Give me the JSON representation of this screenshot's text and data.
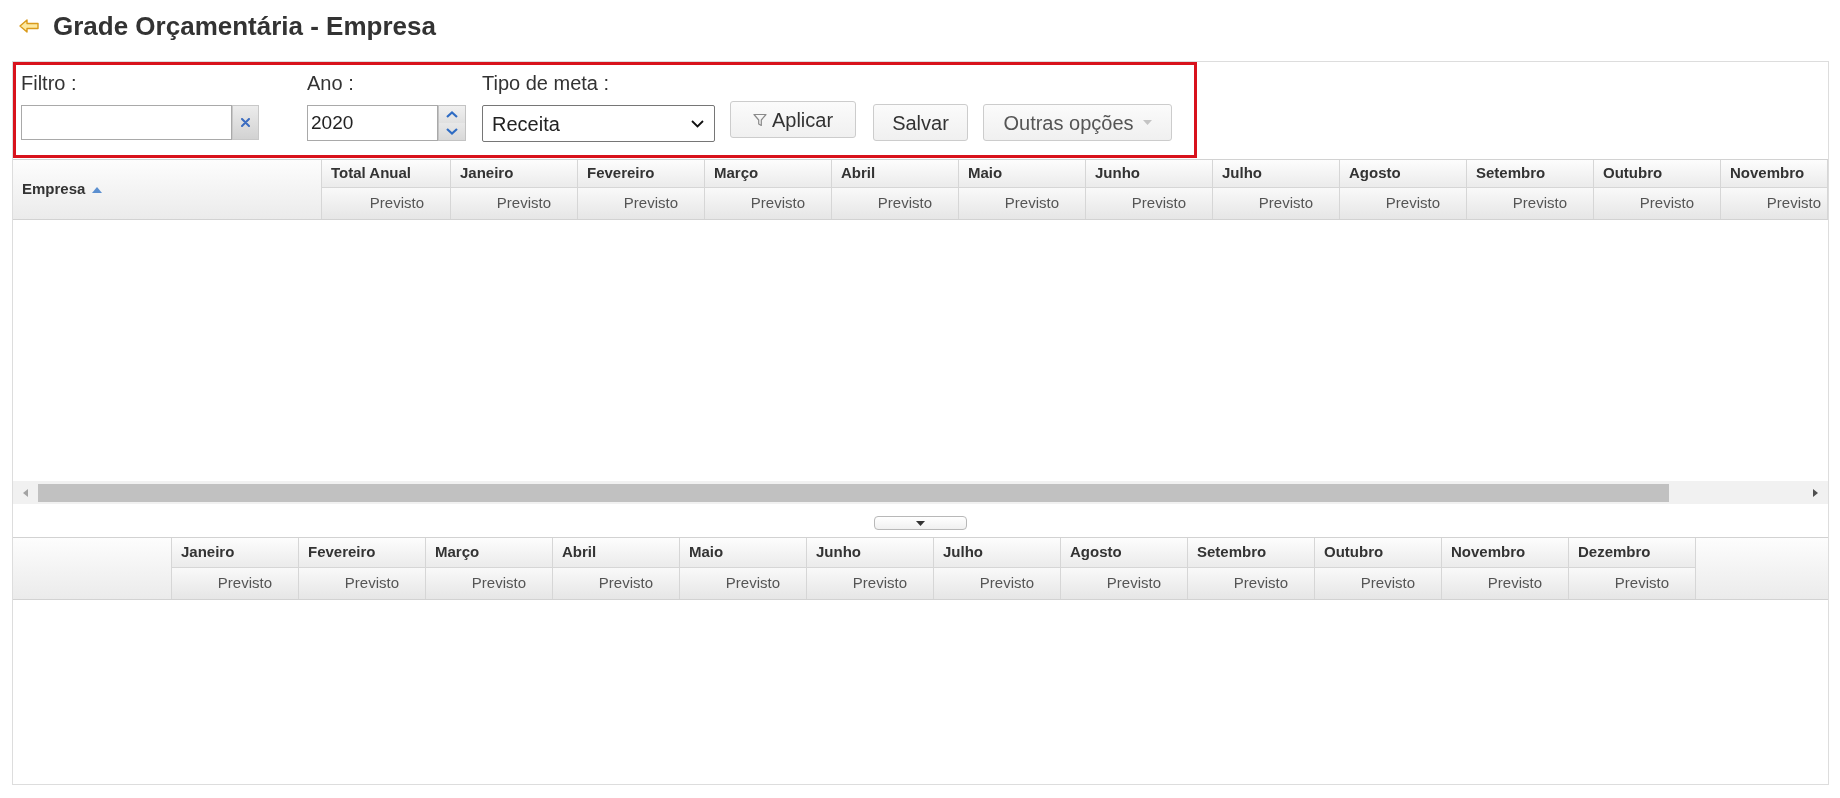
{
  "page": {
    "title": "Grade Orçamentária - Empresa"
  },
  "filters": {
    "highlighted": true,
    "filter": {
      "label": "Filtro :"
    },
    "year": {
      "label": "Ano :",
      "value": "2020"
    },
    "goal_type": {
      "label": "Tipo de meta :",
      "value": "Receita"
    },
    "buttons": [
      {
        "kind": "filter",
        "label": "Aplicar"
      },
      {
        "kind": "plain",
        "label": "Salvar"
      },
      {
        "kind": "menu",
        "label": "Outras opções"
      }
    ]
  },
  "main_grid": {
    "row_header": {
      "label": "Empresa",
      "sorted": true
    },
    "columns": [
      {
        "label": "Total Anual",
        "sub_label": "Previsto"
      },
      {
        "label": "Janeiro",
        "sub_label": "Previsto"
      },
      {
        "label": "Fevereiro",
        "sub_label": "Previsto"
      },
      {
        "label": "Março",
        "sub_label": "Previsto"
      },
      {
        "label": "Abril",
        "sub_label": "Previsto"
      },
      {
        "label": "Maio",
        "sub_label": "Previsto"
      },
      {
        "label": "Junho",
        "sub_label": "Previsto"
      },
      {
        "label": "Julho",
        "sub_label": "Previsto"
      },
      {
        "label": "Agosto",
        "sub_label": "Previsto"
      },
      {
        "label": "Setembro",
        "sub_label": "Previsto"
      },
      {
        "label": "Outubro",
        "sub_label": "Previsto"
      },
      {
        "label": "Novembro",
        "sub_label": "Previsto"
      }
    ]
  },
  "detail_grid": {
    "columns": [
      {
        "label": "Janeiro",
        "sub_label": "Previsto"
      },
      {
        "label": "Fevereiro",
        "sub_label": "Previsto"
      },
      {
        "label": "Março",
        "sub_label": "Previsto"
      },
      {
        "label": "Abril",
        "sub_label": "Previsto"
      },
      {
        "label": "Maio",
        "sub_label": "Previsto"
      },
      {
        "label": "Junho",
        "sub_label": "Previsto"
      },
      {
        "label": "Julho",
        "sub_label": "Previsto"
      },
      {
        "label": "Agosto",
        "sub_label": "Previsto"
      },
      {
        "label": "Setembro",
        "sub_label": "Previsto"
      },
      {
        "label": "Outubro",
        "sub_label": "Previsto"
      },
      {
        "label": "Novembro",
        "sub_label": "Previsto"
      },
      {
        "label": "Dezembro",
        "sub_label": "Previsto"
      }
    ]
  }
}
